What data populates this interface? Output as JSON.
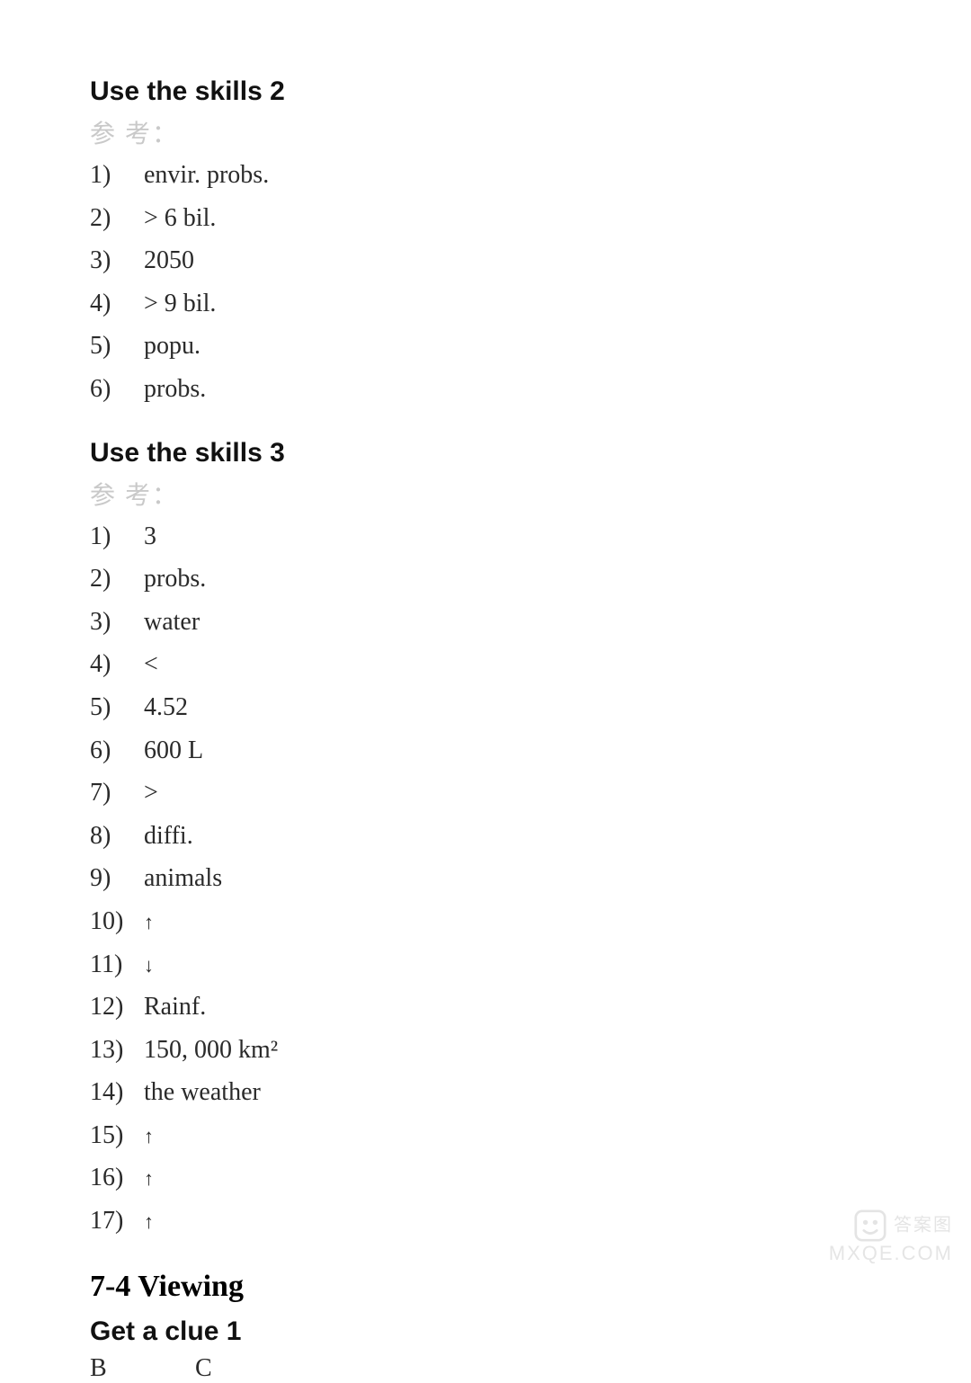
{
  "sections": {
    "skills2": {
      "title": "Use the skills 2",
      "reference_label": "参 考：",
      "items": [
        {
          "num": "1)",
          "val": "envir. probs."
        },
        {
          "num": "2)",
          "val": "> 6 bil."
        },
        {
          "num": "3)",
          "val": "2050"
        },
        {
          "num": "4)",
          "val": "> 9 bil."
        },
        {
          "num": "5)",
          "val": "popu."
        },
        {
          "num": "6)",
          "val": "probs."
        }
      ]
    },
    "skills3": {
      "title": "Use the skills 3",
      "reference_label": "参 考：",
      "items": [
        {
          "num": "1)",
          "val": "3"
        },
        {
          "num": "2)",
          "val": "probs."
        },
        {
          "num": "3)",
          "val": "water"
        },
        {
          "num": "4)",
          "val": "<"
        },
        {
          "num": "5)",
          "val": "4.52"
        },
        {
          "num": "6)",
          "val": "600 L"
        },
        {
          "num": "7)",
          "val": ">"
        },
        {
          "num": "8)",
          "val": "diffi."
        },
        {
          "num": "9)",
          "val": "animals"
        },
        {
          "num": "10)",
          "val": "↑"
        },
        {
          "num": "11)",
          "val": "↓"
        },
        {
          "num": "12)",
          "val": "Rainf."
        },
        {
          "num": "13)",
          "val": "150, 000 km²"
        },
        {
          "num": "14)",
          "val": "the weather"
        },
        {
          "num": "15)",
          "val": "↑"
        },
        {
          "num": "16)",
          "val": "↑"
        },
        {
          "num": "17)",
          "val": "↑"
        }
      ]
    },
    "viewing": {
      "title": "7-4 Viewing"
    },
    "clue1": {
      "title": "Get a clue 1",
      "answers": [
        "B",
        "C"
      ]
    }
  },
  "watermark": {
    "line1": "答案图",
    "line2": "MXQE.COM"
  }
}
